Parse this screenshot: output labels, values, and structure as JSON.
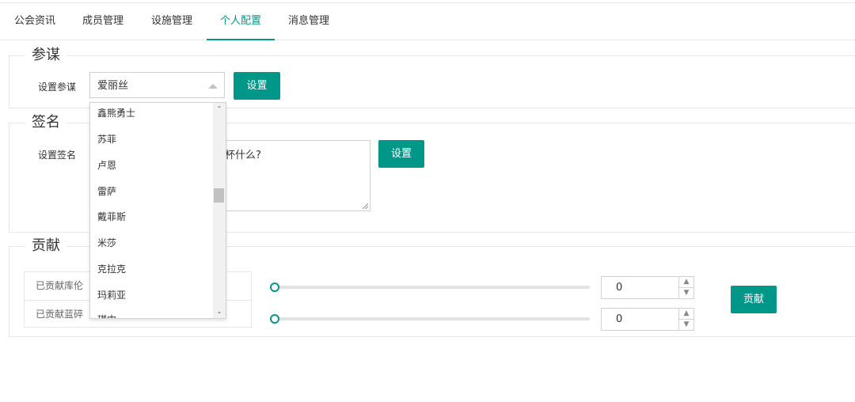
{
  "tabs": [
    {
      "label": "公会资讯"
    },
    {
      "label": "成员管理"
    },
    {
      "label": "设施管理"
    },
    {
      "label": "个人配置"
    },
    {
      "label": "消息管理"
    }
  ],
  "advisor": {
    "legend": "参谋",
    "label": "设置参谋",
    "selected": "爱丽丝",
    "button": "设置",
    "options": [
      "鑫熊勇士",
      "苏菲",
      "卢恩",
      "雷萨",
      "戴菲斯",
      "米莎",
      "克拉克",
      "玛莉亚",
      "琪中"
    ]
  },
  "signature": {
    "legend": "签名",
    "label": "设置签名",
    "value_visible": "来杯什么?",
    "button": "设置"
  },
  "contribute": {
    "legend": "贡献",
    "rows": [
      {
        "label": "已贡献库伦",
        "amount": "0",
        "slider_fraction": 0
      },
      {
        "label": "已贡献蓝碎",
        "amount": "0",
        "slider_fraction": 0
      }
    ],
    "button": "贡献"
  },
  "colors": {
    "accent": "#009688",
    "border": "#e6e6e6"
  },
  "icons": {
    "caret": "caret-up-icon",
    "spin_up": "chevron-up-icon",
    "spin_down": "chevron-down-icon",
    "resize": "resize-grip-icon"
  }
}
